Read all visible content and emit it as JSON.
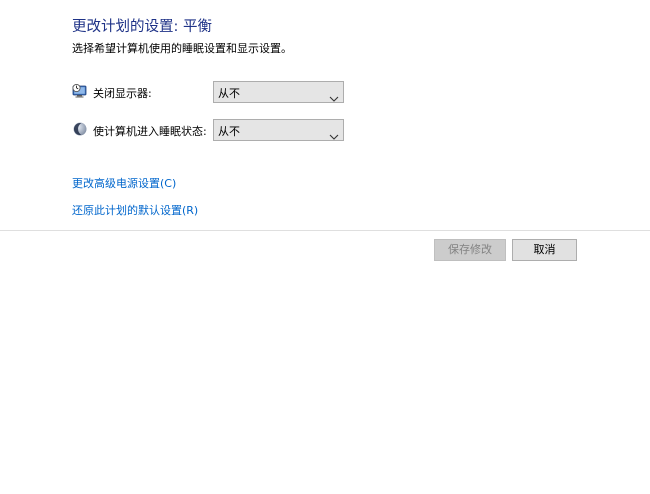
{
  "header": {
    "title": "更改计划的设置: 平衡",
    "subtitle": "选择希望计算机使用的睡眠设置和显示设置。"
  },
  "settings": {
    "display_off": {
      "label": "关闭显示器:",
      "value": "从不",
      "icon": "monitor-clock-icon"
    },
    "sleep": {
      "label": "使计算机进入睡眠状态:",
      "value": "从不",
      "icon": "moon-icon"
    }
  },
  "links": {
    "advanced": "更改高级电源设置(C)",
    "restore": "还原此计划的默认设置(R)"
  },
  "buttons": {
    "save": "保存修改",
    "cancel": "取消"
  },
  "colors": {
    "title": "#1e3287",
    "link": "#0066cc",
    "background": "#ffffff"
  }
}
